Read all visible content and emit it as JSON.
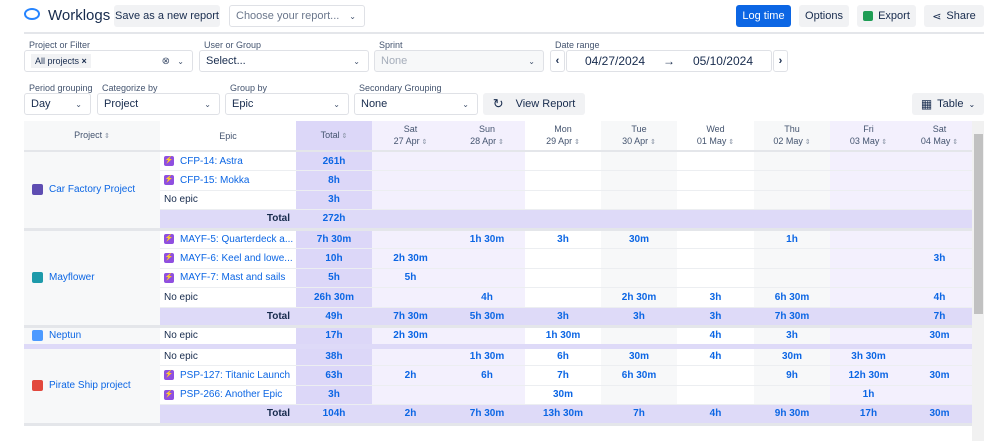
{
  "header": {
    "title": "Worklogs",
    "save_label": "Save as a new report",
    "report_placeholder": "Choose your report...",
    "log_time": "Log time",
    "options": "Options",
    "export": "Export",
    "share": "Share"
  },
  "filters": {
    "project_label": "Project or Filter",
    "project_chip": "All projects",
    "user_label": "User or Group",
    "user_value": "Select...",
    "sprint_label": "Sprint",
    "sprint_value": "None",
    "date_label": "Date range",
    "date_from": "04/27/2024",
    "date_to": "05/10/2024",
    "period_label": "Period grouping",
    "period_value": "Day",
    "categorize_label": "Categorize by",
    "categorize_value": "Project",
    "group_label": "Group by",
    "group_value": "Epic",
    "secondary_label": "Secondary Grouping",
    "secondary_value": "None",
    "view_report": "View Report",
    "view_mode": "Table"
  },
  "colors": {
    "accent": "#0c66e4",
    "total_col": "#dcd7f8",
    "weekend_col": "#f3f0fd",
    "epic_icon": "#8f4fe0"
  },
  "table": {
    "headers": {
      "project": "Project",
      "epic": "Epic",
      "total": "Total"
    },
    "days": [
      {
        "d": "Sat",
        "date": "27 Apr",
        "c": "we"
      },
      {
        "d": "Sun",
        "date": "28 Apr",
        "c": "we"
      },
      {
        "d": "Mon",
        "date": "29 Apr",
        "c": "wh"
      },
      {
        "d": "Tue",
        "date": "30 Apr",
        "c": "gr"
      },
      {
        "d": "Wed",
        "date": "01 May",
        "c": "wh"
      },
      {
        "d": "Thu",
        "date": "02 May",
        "c": "gr"
      },
      {
        "d": "Fri",
        "date": "03 May",
        "c": "we"
      },
      {
        "d": "Sat",
        "date": "04 May",
        "c": "we"
      }
    ],
    "total_label": "Total",
    "projects": [
      {
        "name": "Car Factory Project",
        "icon": "#5e4db2",
        "rows": [
          {
            "epic": "CFP-14: Astra",
            "is_epic": true,
            "total": "261h",
            "days": [
              "",
              "",
              "",
              "",
              "",
              "",
              "",
              ""
            ]
          },
          {
            "epic": "CFP-15: Mokka",
            "is_epic": true,
            "total": "8h",
            "days": [
              "",
              "",
              "",
              "",
              "",
              "",
              "",
              ""
            ]
          },
          {
            "epic": "No epic",
            "is_epic": false,
            "total": "3h",
            "days": [
              "",
              "",
              "",
              "",
              "",
              "",
              "",
              ""
            ]
          }
        ],
        "total": {
          "total": "272h",
          "days": [
            "",
            "",
            "",
            "",
            "",
            "",
            "",
            ""
          ]
        }
      },
      {
        "name": "Mayflower",
        "icon": "#1d9aaa",
        "rows": [
          {
            "epic": "MAYF-5: Quarterdeck a...",
            "is_epic": true,
            "total": "7h 30m",
            "days": [
              "",
              "1h 30m",
              "3h",
              "30m",
              "",
              "1h",
              "",
              ""
            ]
          },
          {
            "epic": "MAYF-6: Keel and lowe...",
            "is_epic": true,
            "total": "10h",
            "days": [
              "2h 30m",
              "",
              "",
              "",
              "",
              "",
              "",
              "3h"
            ]
          },
          {
            "epic": "MAYF-7: Mast and sails",
            "is_epic": true,
            "total": "5h",
            "days": [
              "5h",
              "",
              "",
              "",
              "",
              "",
              "",
              ""
            ]
          },
          {
            "epic": "No epic",
            "is_epic": false,
            "total": "26h 30m",
            "days": [
              "",
              "4h",
              "",
              "2h 30m",
              "3h",
              "6h 30m",
              "",
              "4h"
            ]
          }
        ],
        "total": {
          "total": "49h",
          "days": [
            "7h 30m",
            "5h 30m",
            "3h",
            "3h",
            "3h",
            "7h 30m",
            "",
            "7h"
          ]
        }
      },
      {
        "name": "Neptun",
        "icon": "#4c9aff",
        "rows": [
          {
            "epic": "No epic",
            "is_epic": false,
            "total": "17h",
            "days": [
              "2h 30m",
              "",
              "1h 30m",
              "",
              "4h",
              "3h",
              "",
              "30m"
            ]
          }
        ],
        "total": null
      },
      {
        "name": "Pirate Ship project",
        "icon": "#e2483d",
        "rows": [
          {
            "epic": "No epic",
            "is_epic": false,
            "total": "38h",
            "days": [
              "",
              "1h 30m",
              "6h",
              "30m",
              "4h",
              "30m",
              "3h 30m",
              ""
            ]
          },
          {
            "epic": "PSP-127: Titanic Launch",
            "is_epic": true,
            "total": "63h",
            "days": [
              "2h",
              "6h",
              "7h",
              "6h 30m",
              "",
              "9h",
              "12h 30m",
              "30m"
            ]
          },
          {
            "epic": "PSP-266: Another Epic",
            "is_epic": true,
            "total": "3h",
            "days": [
              "",
              "",
              "30m",
              "",
              "",
              "",
              "1h",
              ""
            ]
          }
        ],
        "total": {
          "total": "104h",
          "days": [
            "2h",
            "7h 30m",
            "13h 30m",
            "7h",
            "4h",
            "9h 30m",
            "17h",
            "30m"
          ]
        }
      }
    ]
  }
}
